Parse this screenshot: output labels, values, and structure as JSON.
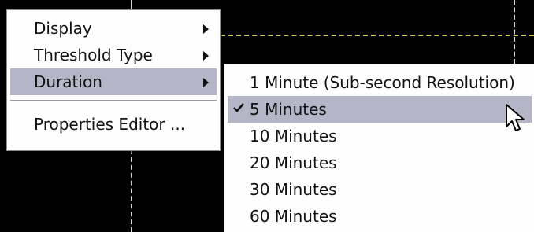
{
  "context_menu": {
    "items": [
      {
        "label": "Display",
        "has_submenu": true
      },
      {
        "label": "Threshold Type",
        "has_submenu": true
      },
      {
        "label": "Duration",
        "has_submenu": true,
        "highlighted": true
      },
      {
        "label": "Properties Editor ...",
        "has_submenu": false
      }
    ]
  },
  "duration_submenu": {
    "items": [
      {
        "label": "1 Minute (Sub-second Resolution)",
        "checked": false
      },
      {
        "label": "5 Minutes",
        "checked": true,
        "highlighted": true
      },
      {
        "label": "10 Minutes",
        "checked": false
      },
      {
        "label": "20 Minutes",
        "checked": false
      },
      {
        "label": "30 Minutes",
        "checked": false
      },
      {
        "label": "60 Minutes",
        "checked": false
      }
    ]
  },
  "icons": {
    "submenu_arrow": "chevron-right-icon",
    "check": "check-icon",
    "cursor": "mouse-pointer-icon"
  },
  "colors": {
    "highlight": "#b5b5c8",
    "background": "#000000",
    "chart_line": "#c9c95a"
  }
}
